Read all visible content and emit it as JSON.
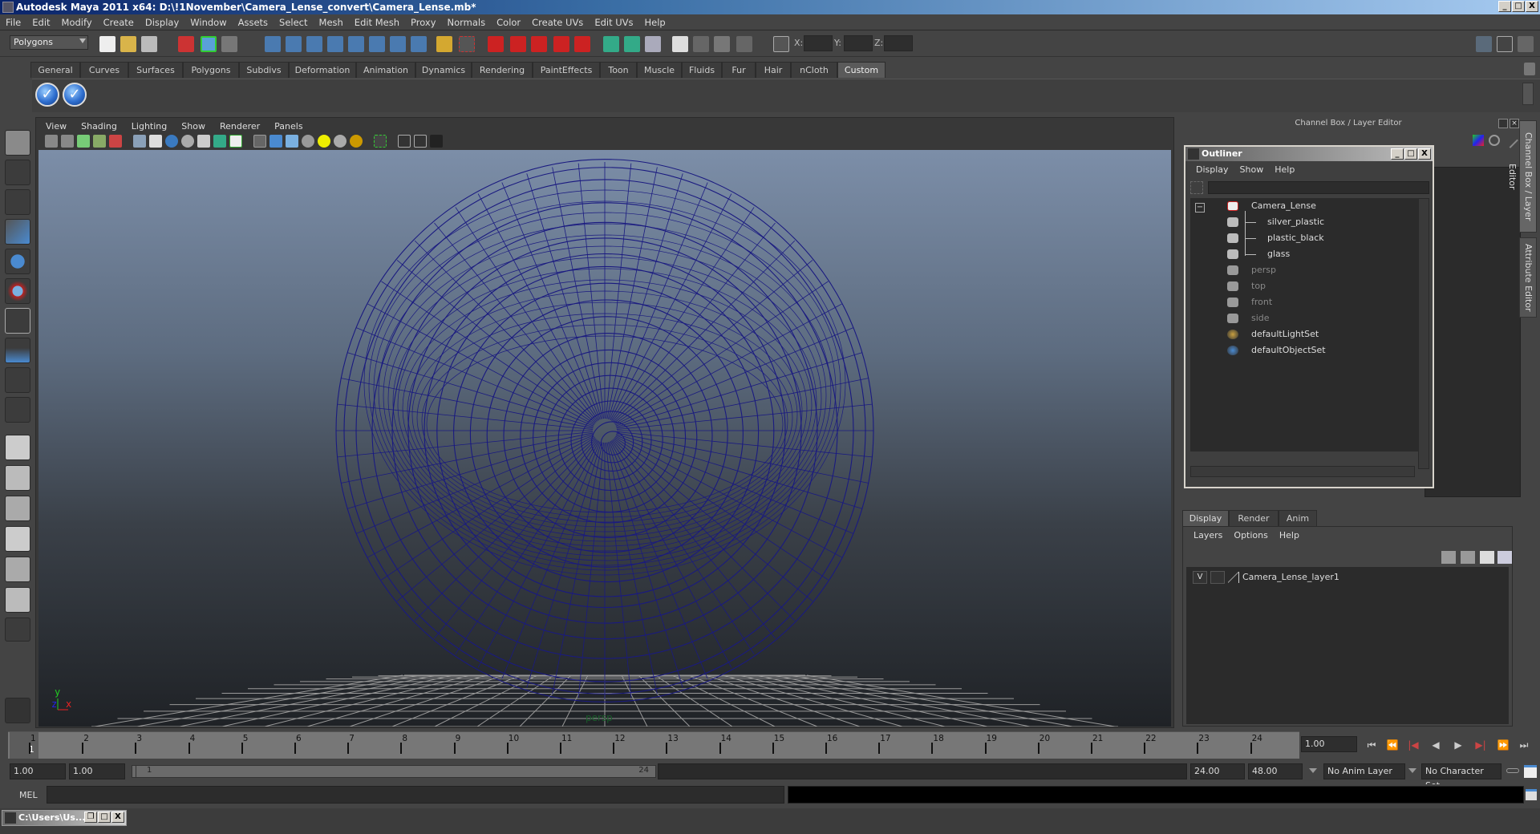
{
  "window": {
    "title": "Autodesk Maya 2011 x64: D:\\!1November\\Camera_Lense_convert\\Camera_Lense.mb*",
    "buttons": [
      "_",
      "□",
      "X"
    ]
  },
  "menubar": [
    "File",
    "Edit",
    "Modify",
    "Create",
    "Display",
    "Window",
    "Assets",
    "Select",
    "Mesh",
    "Edit Mesh",
    "Proxy",
    "Normals",
    "Color",
    "Create UVs",
    "Edit UVs",
    "Help"
  ],
  "statusline": {
    "mode": "Polygons",
    "coord_labels": [
      "X:",
      "Y:",
      "Z:"
    ]
  },
  "shelf": {
    "tabs": [
      "General",
      "Curves",
      "Surfaces",
      "Polygons",
      "Subdivs",
      "Deformation",
      "Animation",
      "Dynamics",
      "Rendering",
      "PaintEffects",
      "Toon",
      "Muscle",
      "Fluids",
      "Fur",
      "Hair",
      "nCloth",
      "Custom"
    ],
    "active_tab": "Custom",
    "buttons": [
      "check-icon",
      "check-icon"
    ],
    "check_glyph": "✓"
  },
  "toolbox": [
    "select-tool",
    "lasso-tool",
    "paint-select-tool",
    "move-tool",
    "rotate-tool",
    "scale-tool",
    "manipulator-tool",
    "soft-mod-tool",
    "last-tool"
  ],
  "viewport": {
    "menu": [
      "View",
      "Shading",
      "Lighting",
      "Show",
      "Renderer",
      "Panels"
    ],
    "camera_label": "persp",
    "axis": {
      "x": "x",
      "y": "y",
      "z": "z"
    },
    "wire_color": "#1a1a80"
  },
  "channel_box": {
    "title": "Channel Box / Layer Editor"
  },
  "outliner": {
    "title": "Outliner",
    "menu": [
      "Display",
      "Show",
      "Help"
    ],
    "items": [
      {
        "label": "Camera_Lense",
        "type": "transform",
        "dim": false,
        "indent": 0
      },
      {
        "label": "silver_plastic",
        "type": "mesh",
        "dim": false,
        "indent": 1
      },
      {
        "label": "plastic_black",
        "type": "mesh",
        "dim": false,
        "indent": 1
      },
      {
        "label": "glass",
        "type": "mesh",
        "dim": false,
        "indent": 1
      },
      {
        "label": "persp",
        "type": "camera",
        "dim": true,
        "indent": 0
      },
      {
        "label": "top",
        "type": "camera",
        "dim": true,
        "indent": 0
      },
      {
        "label": "front",
        "type": "camera",
        "dim": true,
        "indent": 0
      },
      {
        "label": "side",
        "type": "camera",
        "dim": true,
        "indent": 0
      },
      {
        "label": "defaultLightSet",
        "type": "set",
        "dim": false,
        "indent": 0
      },
      {
        "label": "defaultObjectSet",
        "type": "set",
        "dim": false,
        "indent": 0
      }
    ]
  },
  "layer_editor": {
    "tabs": [
      "Display",
      "Render",
      "Anim"
    ],
    "active_tab": "Display",
    "menu": [
      "Layers",
      "Options",
      "Help"
    ],
    "layers": [
      {
        "visible": "V",
        "name": "Camera_Lense_layer1"
      }
    ]
  },
  "side_tabs": [
    "Channel Box / Layer Editor",
    "Attribute Editor"
  ],
  "timeline": {
    "frames": [
      "1",
      "2",
      "3",
      "4",
      "5",
      "6",
      "7",
      "8",
      "9",
      "10",
      "11",
      "12",
      "13",
      "14",
      "15",
      "16",
      "17",
      "18",
      "19",
      "20",
      "21",
      "22",
      "23",
      "24"
    ],
    "current_frame_marker": "1",
    "current_time": "1.00",
    "playback_buttons": [
      "⏮",
      "⏪",
      "|◀",
      "◀",
      "▶",
      "▶|",
      "⏩",
      "⏭"
    ]
  },
  "range": {
    "start": "1.00",
    "playback_start": "1.00",
    "slider_start": "1",
    "slider_end": "24",
    "playback_end": "24.00",
    "end": "48.00",
    "anim_layer": "No Anim Layer",
    "character_set": "No Character Set"
  },
  "command_line": {
    "label": "MEL",
    "value": ""
  },
  "taskbar": {
    "item": "C:\\Users\\Us..."
  }
}
